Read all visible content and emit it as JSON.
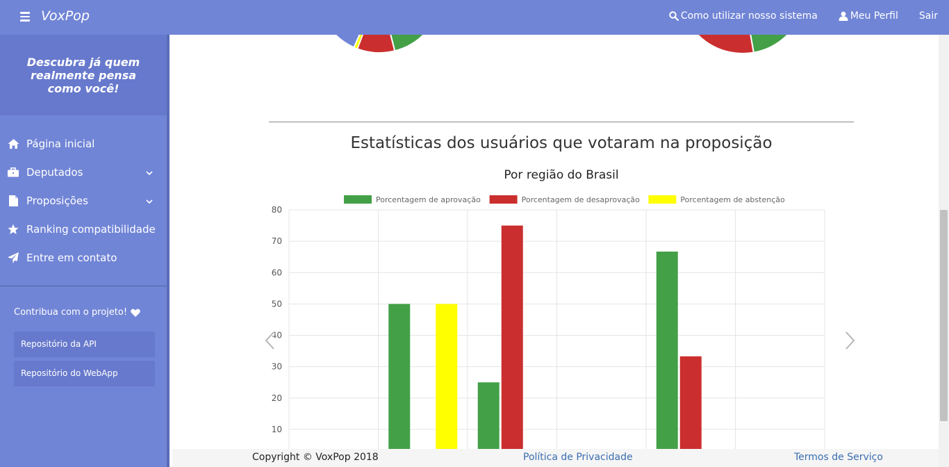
{
  "header": {
    "brand": "VoxPop",
    "links": [
      {
        "label": "Como utilizar nosso sistema",
        "icon": "search-icon"
      },
      {
        "label": "Meu Perfil",
        "icon": "user-icon"
      },
      {
        "label": "Sair",
        "icon": ""
      }
    ]
  },
  "sidebar": {
    "tagline": "Descubra já quem realmente pensa como você!",
    "items": [
      {
        "label": "Página inicial",
        "icon": "home-icon",
        "dropdown": false
      },
      {
        "label": "Deputados",
        "icon": "briefcase-icon",
        "dropdown": true
      },
      {
        "label": "Proposições",
        "icon": "file-icon",
        "dropdown": true
      },
      {
        "label": "Ranking compatibilidade",
        "icon": "star-icon",
        "dropdown": false
      },
      {
        "label": "Entre em contato",
        "icon": "send-icon",
        "dropdown": false
      }
    ],
    "contribute": "Contribua com o projeto!",
    "repos": [
      "Repositório da API",
      "Repositório do WebApp"
    ]
  },
  "main": {
    "stats_title": "Estatísticas dos usuários que votaram na proposição"
  },
  "colors": {
    "approve": "#43a047",
    "disapprove": "#cb2e2e",
    "abstain": "#ffff00",
    "other": "#7185d6",
    "accent": "#7185d6"
  },
  "chart_data": {
    "type": "bar",
    "title": "Por região do Brasil",
    "categories": [
      "",
      "",
      "",
      "",
      "",
      ""
    ],
    "series": [
      {
        "name": "Porcentagem de aprovação",
        "values": [
          null,
          50,
          25,
          null,
          66.7,
          null
        ]
      },
      {
        "name": "Porcentagem de desaprovação",
        "values": [
          null,
          null,
          75,
          null,
          33.3,
          null
        ]
      },
      {
        "name": "Porcentagem de abstenção",
        "values": [
          null,
          50,
          null,
          null,
          null,
          null
        ]
      }
    ],
    "yticks": [
      10,
      20,
      30,
      40,
      50,
      60,
      70,
      80
    ],
    "ylim": [
      0,
      80
    ],
    "grid": true,
    "legend": "top"
  },
  "footer": {
    "copyright": "Copyright © VoxPop 2018",
    "privacy": "Política de Privacidade",
    "terms": "Termos de Serviço"
  }
}
